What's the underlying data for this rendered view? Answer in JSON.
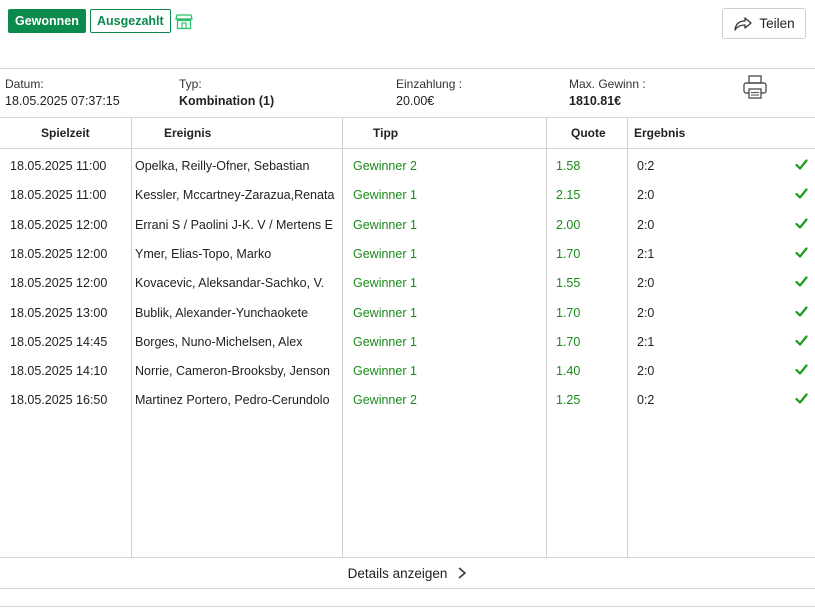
{
  "header": {
    "status_won": "Gewonnen",
    "status_paid": "Ausgezahlt",
    "share_label": "Teilen"
  },
  "meta": {
    "date_label": "Datum:",
    "date_value": "18.05.2025 07:37:15",
    "type_label": "Typ:",
    "type_value": "Kombination (1)",
    "stake_label": "Einzahlung :",
    "stake_value": "20.00€",
    "max_label": "Max. Gewinn :",
    "max_value": "1810.81€"
  },
  "table": {
    "columns": [
      "Spielzeit",
      "Ereignis",
      "Tipp",
      "Quote",
      "Ergebnis"
    ],
    "rows": [
      {
        "time": "18.05.2025 11:00",
        "event": "Opelka, Reilly-Ofner, Sebastian",
        "tip": "Gewinner 2",
        "quote": "1.58",
        "result": "0:2"
      },
      {
        "time": "18.05.2025 11:00",
        "event": "Kessler, Mccartney-Zarazua,Renata",
        "tip": "Gewinner 1",
        "quote": "2.15",
        "result": "2:0"
      },
      {
        "time": "18.05.2025 12:00",
        "event": "Errani S / Paolini J-K. V / Mertens E",
        "tip": "Gewinner 1",
        "quote": "2.00",
        "result": "2:0"
      },
      {
        "time": "18.05.2025 12:00",
        "event": "Ymer, Elias-Topo, Marko",
        "tip": "Gewinner 1",
        "quote": "1.70",
        "result": "2:1"
      },
      {
        "time": "18.05.2025 12:00",
        "event": "Kovacevic, Aleksandar-Sachko, V.",
        "tip": "Gewinner 1",
        "quote": "1.55",
        "result": "2:0"
      },
      {
        "time": "18.05.2025 13:00",
        "event": "Bublik, Alexander-Yunchaokete",
        "tip": "Gewinner 1",
        "quote": "1.70",
        "result": "2:0"
      },
      {
        "time": "18.05.2025 14:45",
        "event": "Borges, Nuno-Michelsen, Alex",
        "tip": "Gewinner 1",
        "quote": "1.70",
        "result": "2:1"
      },
      {
        "time": "18.05.2025 14:10",
        "event": "Norrie, Cameron-Brooksby, Jenson",
        "tip": "Gewinner 1",
        "quote": "1.40",
        "result": "2:0"
      },
      {
        "time": "18.05.2025 16:50",
        "event": "Martinez Portero, Pedro-Cerundolo",
        "tip": "Gewinner 2",
        "quote": "1.25",
        "result": "0:2"
      }
    ]
  },
  "footer": {
    "details_label": "Details anzeigen"
  },
  "icons": {
    "shop": "shop-icon",
    "share": "share-icon",
    "print": "printer-icon",
    "check": "check-icon",
    "chevron": "chevron-right-icon"
  },
  "colors": {
    "brand_green": "#0a8a4c",
    "tip_green": "#1a8a1a",
    "check_green": "#1c9a1c"
  }
}
